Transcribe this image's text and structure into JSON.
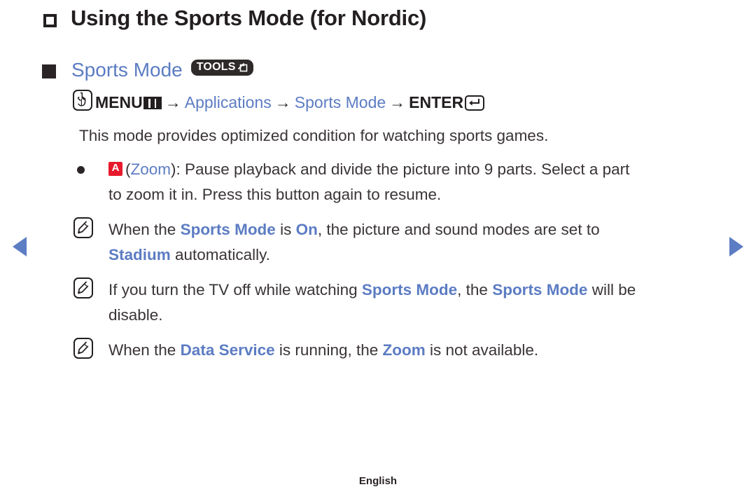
{
  "page": {
    "title": "Using the Sports Mode (for Nordic)",
    "footer_language": "English"
  },
  "section": {
    "heading": "Sports Mode",
    "tools_badge_label": "TOOLS"
  },
  "nav": {
    "prev_icon": "triangle-left-icon",
    "next_icon": "triangle-right-icon",
    "arrow_color": "#5c7cc3"
  },
  "menu_path": {
    "icon": "touch-hand-icon",
    "step1": "MENU",
    "menu_glyph": "menu-grid-icon",
    "arrow1": "→",
    "step2": "Applications",
    "arrow2": "→",
    "step3": "Sports Mode",
    "arrow3": "→",
    "step4": "ENTER",
    "enter_glyph": "enter-return-icon"
  },
  "intro": {
    "text": "This mode provides optimized condition for watching sports games."
  },
  "bullets": [
    {
      "marker": "dot-bullet",
      "badge": "A",
      "line1_open": "(",
      "line1_blue": "Zoom",
      "line1_rest": "): Pause playback and divide the picture into 9 parts. Select a part",
      "line2": "to zoom it in. Press this button again to resume."
    }
  ],
  "notes": [
    {
      "marker": "note-pencil-icon",
      "line1": [
        {
          "t": "When the ",
          "s": "plain"
        },
        {
          "t": "Sports Mode",
          "s": "blue-bold"
        },
        {
          "t": " is ",
          "s": "plain"
        },
        {
          "t": "On",
          "s": "blue-bold"
        },
        {
          "t": ", the picture and sound modes are set to",
          "s": "plain"
        }
      ],
      "line2": [
        {
          "t": "Stadium",
          "s": "blue-bold"
        },
        {
          "t": " automatically.",
          "s": "plain"
        }
      ]
    },
    {
      "marker": "note-pencil-icon",
      "line1": [
        {
          "t": "If you turn the TV off while watching ",
          "s": "plain"
        },
        {
          "t": "Sports Mode",
          "s": "blue-bold"
        },
        {
          "t": ", the ",
          "s": "plain"
        },
        {
          "t": "Sports Mode",
          "s": "blue-bold"
        },
        {
          "t": " will be",
          "s": "plain"
        }
      ],
      "line2": [
        {
          "t": "disable.",
          "s": "plain"
        }
      ]
    },
    {
      "marker": "note-pencil-icon",
      "line1": [
        {
          "t": "When the ",
          "s": "plain"
        },
        {
          "t": "Data Service",
          "s": "blue-bold"
        },
        {
          "t": " is running, the ",
          "s": "plain"
        },
        {
          "t": "Zoom",
          "s": "blue-bold"
        },
        {
          "t": " is not available.",
          "s": "plain"
        }
      ],
      "line2": []
    }
  ],
  "colors": {
    "accent_blue": "#5c7cc3",
    "red_badge": "#e8192c",
    "text": "#3a3436",
    "heading": "#231f20"
  }
}
